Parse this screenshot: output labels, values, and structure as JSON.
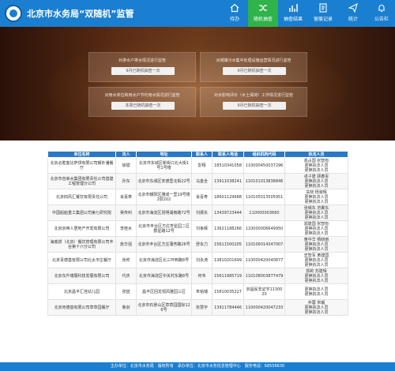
{
  "header": {
    "title": "北京市水务局“双随机”监管",
    "nav": [
      {
        "label": "待办",
        "icon": "home-icon"
      },
      {
        "label": "随机抽查",
        "icon": "shuffle-icon"
      },
      {
        "label": "抽查结果",
        "icon": "bar-chart-icon"
      },
      {
        "label": "留痕记录",
        "icon": "document-icon"
      },
      {
        "label": "统计",
        "icon": "send-icon"
      },
      {
        "label": "公告栏",
        "icon": "bell-icon"
      }
    ],
    "active_color": "#2fb34a",
    "bar_color": "#1a7fd0"
  },
  "cards": [
    {
      "title": "对排水户排水情况进行监管",
      "button": "9月已随机抽查一次"
    },
    {
      "title": "对城镇污水集中处理设施运营情况进行监管",
      "button": "9月已随机抽查一次"
    },
    {
      "title": "对用水单位和用水户节约用水情况进行监管",
      "button": "本周已随机抽查一次"
    },
    {
      "title": "对水影响评价（水土保持）工作情况进行监管",
      "button": "9月已随机抽查一次"
    }
  ],
  "table": {
    "headers": [
      "单位名称",
      "法人",
      "地址",
      "联系人",
      "联系人电话",
      "组织机构代码",
      "执法人员"
    ],
    "rows": [
      {
        "name": "北京必胜客比萨饼有限公司朝外潘餐厅",
        "legal": "徐斌",
        "address": "北京市东城区新街口北大街1号1号楼",
        "contact": "彭翔",
        "phone": "18510341058",
        "code": "110000450037296",
        "officers": "高占国 张智有",
        "links": [
          "更换执法人员",
          "更换执法人员"
        ]
      },
      {
        "name": "北京市自来水集团有限责任公司基建工程管理分公司",
        "legal": "孙东",
        "address": "北京市东城区安德里北街22号",
        "contact": "马金全",
        "phone": "13911038241",
        "code": "110101013838846",
        "officers": "卓子建 顾春军",
        "links": [
          "更换执法人员",
          "更换执法人员"
        ]
      },
      {
        "name": "北京四风汇餐饮有限责任公司",
        "legal": "肖喜寿",
        "address": "北京市朝阳区雅成一里19号楼2层202",
        "contact": "肖喜寿",
        "phone": "18601129688",
        "code": "110105013505951",
        "officers": "关晓 杨淑辉",
        "links": [
          "更换执法人员",
          "更换执法人员"
        ]
      },
      {
        "name": "中国船舶重工集团公司第七研究院",
        "legal": "吴传利",
        "address": "北京市海淀区昆明湖南路72号",
        "contact": "刘振东",
        "phone": "13439723444",
        "code": "110000003660",
        "officers": "张锡东 范翼东",
        "links": [
          "更换执法人员",
          "更换执法人员"
        ]
      },
      {
        "name": "北京京帝人居地产开发有限公司",
        "legal": "李桂水",
        "address": "北京市丰台区方庄芳星园二区群星路12号",
        "contact": "刘争辉",
        "phone": "13621188266",
        "code": "110000006649950",
        "officers": "郑建国 张智有",
        "links": [
          "更换执法人员",
          "更换执法人员"
        ]
      },
      {
        "name": "海底捞（北京）餐饮管理有限公司丰台第十六分公司",
        "legal": "詹华强",
        "address": "北京市丰台区方庄蒲芳路26号",
        "contact": "舒永力",
        "phone": "15611500205",
        "code": "110106014347007",
        "officers": "黄中华 杨晓雨",
        "links": [
          "更换执法人员",
          "更换执法人员"
        ]
      },
      {
        "name": "北京青德基有限公司北太平庄餐厅",
        "legal": "张帅",
        "address": "北京市海淀区北三环西路8号",
        "contact": "刘永涛",
        "phone": "13810201699",
        "code": "110000420040877",
        "officers": "史智军 黄建国",
        "links": [
          "更换执法人员",
          "更换执法人员"
        ]
      },
      {
        "name": "北京东升博展科技发展有限公司",
        "legal": "代庆",
        "address": "北京市海淀区中关村东路8号",
        "contact": "何韦",
        "phone": "15611985719",
        "code": "110108003877479",
        "officers": "郭莉 苏建辉",
        "links": [
          "更换执法人员",
          "更换执法人员"
        ]
      },
      {
        "name": "北京昌平汇佳幼儿园",
        "legal": "张喆",
        "address": "昌平区回龙观风雅园三区",
        "contact": "朱铭瑞",
        "phone": "15810035227",
        "code": "京昌民非证字1130020",
        "officers": "",
        "links": [
          "更换执法人员",
          "更换执法人员"
        ]
      },
      {
        "name": "北京肯德基有限公司草草园餐厅",
        "legal": "鲁剑",
        "address": "北京市石景山区草草园国际126号",
        "contact": "张慧宇",
        "phone": "13911784446",
        "code": "110000420047233",
        "officers": "乔蓉 宋岷",
        "links": [
          "更换执法人员",
          "更换执法人员"
        ]
      }
    ]
  },
  "footer": {
    "text": "主办单位：北京市水务局　版权所有　承办单位：北京市水务信息管理中心　服务电话：68556630"
  }
}
